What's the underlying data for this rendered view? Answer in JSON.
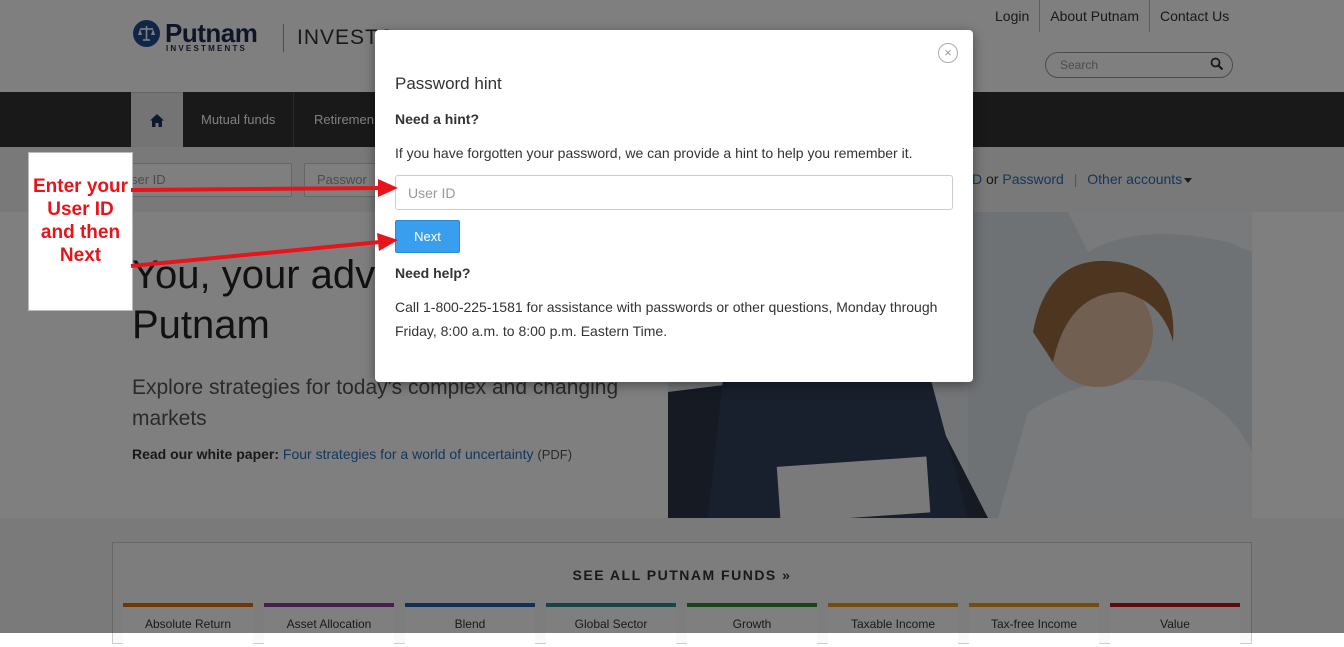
{
  "header": {
    "brand": "Putnam",
    "brand_sub": "INVESTMENTS",
    "section": "INVESTO",
    "util_links": [
      "Login",
      "About Putnam",
      "Contact Us"
    ],
    "search_placeholder": "Search"
  },
  "nav": {
    "items": [
      "Mutual funds",
      "Retiremen"
    ]
  },
  "login_strip": {
    "user_placeholder": "ser ID",
    "password_placeholder": "Passwor",
    "forgot_tail": "D",
    "or": "or",
    "password_link": "Password",
    "other_accounts": "Other accounts"
  },
  "hero": {
    "title_line1": "You, your adv",
    "title_line2": "Putnam",
    "subtitle": "Explore strategies for today's complex and changing markets",
    "read_prefix": "Read our white paper:",
    "read_link": "Four strategies for a world of uncertainty",
    "read_suffix": "(PDF)"
  },
  "funds": {
    "title": "SEE ALL PUTNAM FUNDS »",
    "categories": [
      {
        "label": "Absolute Return",
        "color": "#e36c0a"
      },
      {
        "label": "Asset Allocation",
        "color": "#8e3f9e"
      },
      {
        "label": "Blend",
        "color": "#1e5fae"
      },
      {
        "label": "Global Sector",
        "color": "#2a8c8c"
      },
      {
        "label": "Growth",
        "color": "#2e8b2e"
      },
      {
        "label": "Taxable Income",
        "color": "#e79a1c"
      },
      {
        "label": "Tax-free Income",
        "color": "#e79a1c"
      },
      {
        "label": "Value",
        "color": "#c0141a"
      }
    ]
  },
  "modal": {
    "title": "Password hint",
    "need_hint": "Need a hint?",
    "hint_text": "If you have forgotten your password, we can provide a hint to help you remember it.",
    "user_id_placeholder": "User ID",
    "next_label": "Next",
    "need_help": "Need help?",
    "help_text": "Call 1-800-225-1581 for assistance with passwords or other questions, Monday through Friday, 8:00 a.m. to 8:00 p.m. Eastern Time.",
    "close_glyph": "×"
  },
  "callout": {
    "text": "Enter your User ID and then Next",
    "color": "#e8141a"
  }
}
